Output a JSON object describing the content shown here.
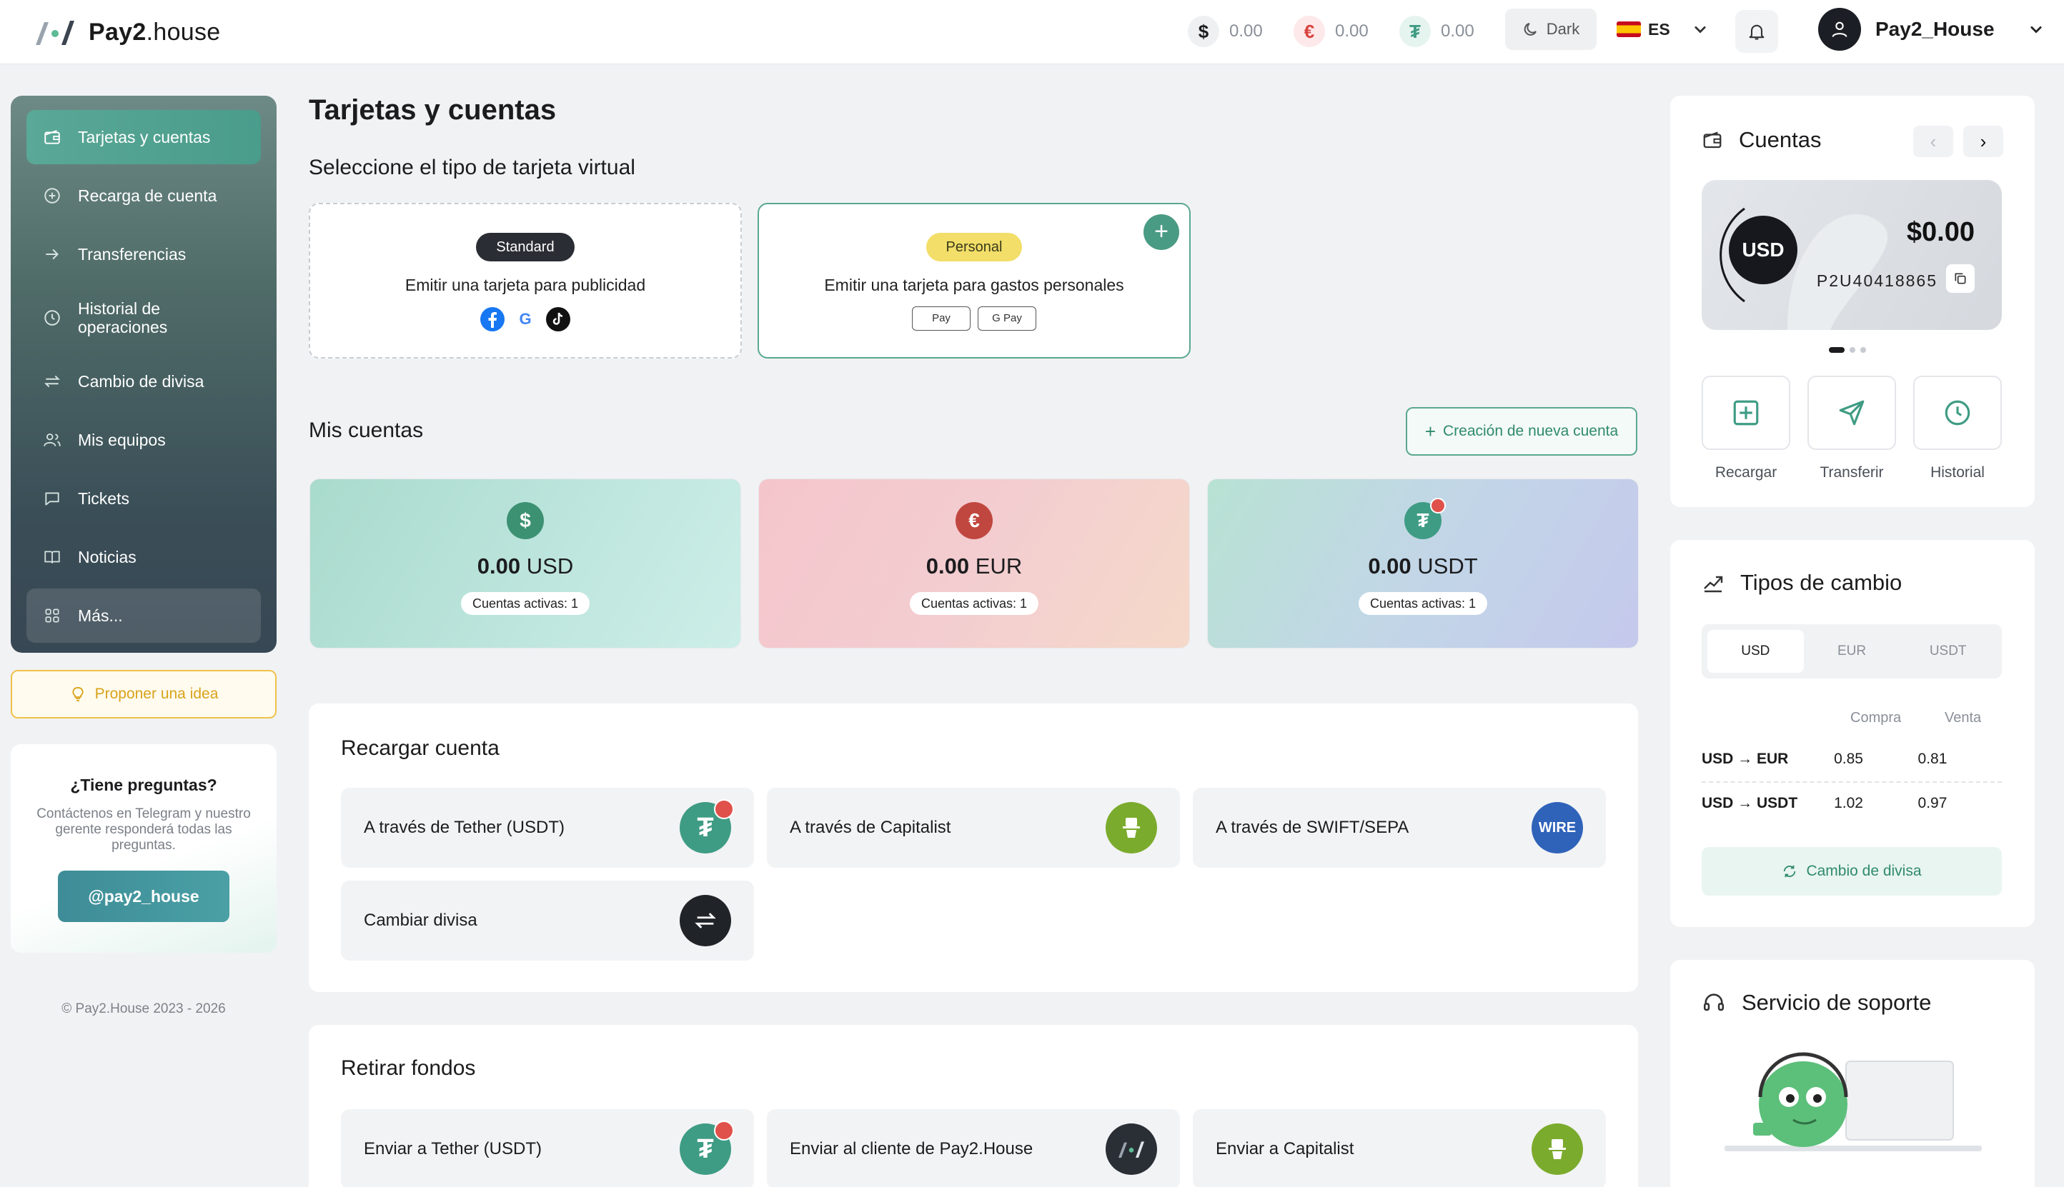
{
  "header": {
    "logo_text_bold": "Pay2",
    "logo_text_rest": ".house",
    "balances": [
      {
        "symbol": "$",
        "value": "0.00",
        "color": "#1c1c1e",
        "bg": "#eef0f2"
      },
      {
        "symbol": "€",
        "value": "0.00",
        "color": "#d8433f",
        "bg": "#fde9e9"
      },
      {
        "symbol": "₮",
        "value": "0.00",
        "color": "#3f9c84",
        "bg": "#e6f4ef"
      }
    ],
    "theme_label": "Dark",
    "language": "ES",
    "username": "Pay2_House"
  },
  "sidebar": {
    "items": [
      {
        "label": "Tarjetas y cuentas",
        "icon": "wallet-icon"
      },
      {
        "label": "Recarga de cuenta",
        "icon": "plus-circle-icon"
      },
      {
        "label": "Transferencias",
        "icon": "arrow-right-icon"
      },
      {
        "label": "Historial de operaciones",
        "icon": "clock-icon"
      },
      {
        "label": "Cambio de divisa",
        "icon": "exchange-icon"
      },
      {
        "label": "Mis equipos",
        "icon": "team-icon"
      },
      {
        "label": "Tickets",
        "icon": "chat-icon"
      },
      {
        "label": "Noticias",
        "icon": "book-icon"
      },
      {
        "label": "Más...",
        "icon": "grid-icon"
      }
    ],
    "idea_button": "Proponer una idea",
    "help": {
      "title": "¿Tiene preguntas?",
      "text": "Contáctenos en Telegram y nuestro gerente responderá todas las preguntas.",
      "button": "@pay2_house"
    },
    "copyright": "© Pay2.House 2023 - 2026"
  },
  "main": {
    "title": "Tarjetas y cuentas",
    "select_title": "Seleccione el tipo de tarjeta virtual",
    "cards": [
      {
        "tag": "Standard",
        "text": "Emitir una tarjeta para publicidad"
      },
      {
        "tag": "Personal",
        "text": "Emitir una tarjeta para gastos personales",
        "pay_badges": [
          " Pay",
          "G Pay"
        ]
      }
    ],
    "accounts_title": "Mis cuentas",
    "new_account_button": "Creación de nueva cuenta",
    "accounts": [
      {
        "amount": "0.00",
        "currency": "USD",
        "active": "Cuentas activas: 1",
        "symbol": "$",
        "color": "#3d9173"
      },
      {
        "amount": "0.00",
        "currency": "EUR",
        "active": "Cuentas activas: 1",
        "symbol": "€",
        "color": "#c0473f"
      },
      {
        "amount": "0.00",
        "currency": "USDT",
        "active": "Cuentas activas: 1",
        "symbol": "₮",
        "color": "#3f9c84"
      }
    ],
    "recharge": {
      "title": "Recargar cuenta",
      "options": [
        {
          "label": "A través de Tether (USDT)",
          "icon": "tether-icon"
        },
        {
          "label": "A través de Capitalist",
          "icon": "capitalist-icon"
        },
        {
          "label": "A través de SWIFT/SEPA",
          "icon": "wire-icon",
          "icon_text": "WIRE"
        },
        {
          "label": "Cambiar divisa",
          "icon": "swap-icon"
        }
      ]
    },
    "withdraw": {
      "title": "Retirar fondos",
      "options": [
        {
          "label": "Enviar a Tether (USDT)",
          "icon": "tether-icon"
        },
        {
          "label": "Enviar al cliente de Pay2.House",
          "icon": "pay2house-icon"
        },
        {
          "label": "Enviar a Capitalist",
          "icon": "capitalist-icon"
        }
      ]
    }
  },
  "right": {
    "accounts_card": {
      "title": "Cuentas",
      "currency": "USD",
      "amount": "$0.00",
      "account_id": "P2U40418865",
      "actions": [
        "Recargar",
        "Transferir",
        "Historial"
      ]
    },
    "rates": {
      "title": "Tipos de cambio",
      "tabs": [
        "USD",
        "EUR",
        "USDT"
      ],
      "active_tab": "USD",
      "col_buy": "Compra",
      "col_sell": "Venta",
      "rows": [
        {
          "pair": "USD → EUR",
          "buy": "0.85",
          "sell": "0.81"
        },
        {
          "pair": "USD → USDT",
          "buy": "1.02",
          "sell": "0.97"
        }
      ],
      "button": "Cambio de divisa"
    },
    "support": {
      "title": "Servicio de soporte"
    }
  }
}
